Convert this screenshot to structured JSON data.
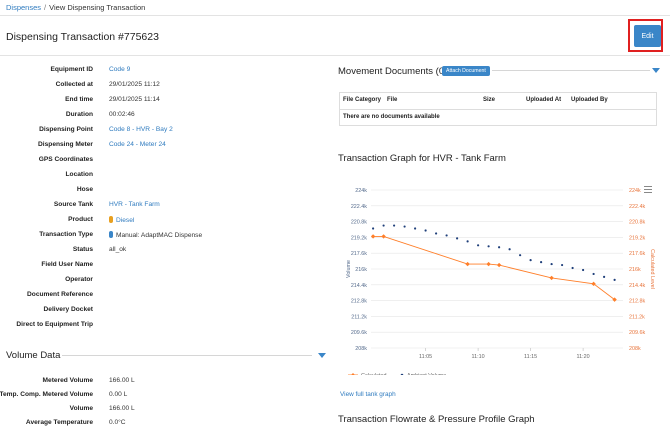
{
  "breadcrumb": {
    "parent": "Dispenses",
    "separator": "/",
    "current": "View Dispensing Transaction"
  },
  "page": {
    "title": "Dispensing Transaction #775623",
    "edit_label": "Edit"
  },
  "details": [
    {
      "label": "Equipment ID",
      "value": "Code 9",
      "link": true
    },
    {
      "label": "Collected at",
      "value": "29/01/2025 11:12",
      "link": false
    },
    {
      "label": "End time",
      "value": "29/01/2025 11:14",
      "link": false
    },
    {
      "label": "Duration",
      "value": "00:02:46",
      "link": false
    },
    {
      "label": "Dispensing Point",
      "value": "Code 8 - HVR - Bay 2",
      "link": true
    },
    {
      "label": "Dispensing Meter",
      "value": "Code 24 - Meter 24",
      "link": true
    },
    {
      "label": "GPS Coordinates",
      "value": "",
      "link": false
    },
    {
      "label": "Location",
      "value": "",
      "link": false
    },
    {
      "label": "Hose",
      "value": "",
      "link": false
    },
    {
      "label": "Source Tank",
      "value": "HVR - Tank Farm",
      "link": true
    },
    {
      "label": "Product",
      "value": "Diesel",
      "link": true,
      "dot": "#e8a020"
    },
    {
      "label": "Transaction Type",
      "value": "Manual: AdaptMAC Dispense",
      "link": false,
      "dot": "#3a86c8"
    },
    {
      "label": "Status",
      "value": "all_ok",
      "link": false
    },
    {
      "label": "Field User Name",
      "value": "",
      "link": false
    },
    {
      "label": "Operator",
      "value": "",
      "link": false
    },
    {
      "label": "Document Reference",
      "value": "",
      "link": false
    },
    {
      "label": "Delivery Docket",
      "value": "",
      "link": false
    },
    {
      "label": "Direct to Equipment Trip",
      "value": "",
      "link": false
    }
  ],
  "volume_section": {
    "title": "Volume Data",
    "rows": [
      {
        "label": "Metered Volume",
        "value": "166.00 L"
      },
      {
        "label": "Temp. Comp. Metered Volume",
        "value": "0.00 L"
      },
      {
        "label": "Volume",
        "value": "166.00 L"
      },
      {
        "label": "Average Temperature",
        "value": "0.0°C"
      }
    ]
  },
  "movement_documents": {
    "title": "Movement Documents (0)",
    "attach_label": "Attach Document",
    "columns": [
      "File Category",
      "File",
      "Size",
      "Uploaded At",
      "Uploaded By"
    ],
    "empty_text": "There are no documents available"
  },
  "transaction_graph": {
    "title": "Transaction Graph for HVR - Tank Farm",
    "view_full_link": "View full tank graph",
    "next_section_title": "Transaction Flowrate & Pressure Profile Graph",
    "colors": {
      "calculated": "#ff7f2a",
      "ambient": "#1f3f7a",
      "left_axis": "#556b8c",
      "right_axis": "#e8743b"
    }
  },
  "chart_data": {
    "type": "line",
    "ylabel_left": "Volume",
    "ylabel_right": "Calculated Level",
    "y_ticks_left": [
      "224k",
      "222.4k",
      "220.8k",
      "219.2k",
      "217.6k",
      "216k",
      "214.4k",
      "212.8k",
      "211.2k",
      "209.6k",
      "208k"
    ],
    "y_ticks_right": [
      "224k",
      "222.4k",
      "220.8k",
      "219.2k",
      "217.6k",
      "216k",
      "214.4k",
      "212.8k",
      "211.2k",
      "209.6k",
      "208k"
    ],
    "x_ticks": [
      "11:05",
      "11:10",
      "11:15",
      "11:20"
    ],
    "ylim": [
      208000,
      224000
    ],
    "xlim_minutes": [
      11.0,
      11.4
    ],
    "series": [
      {
        "name": "Calculated",
        "marker": "diamond",
        "x": [
          "11:00",
          "11:01",
          "11:09",
          "11:11",
          "11:12",
          "11:17",
          "11:21",
          "11:23"
        ],
        "y": [
          219300,
          219300,
          216500,
          216500,
          216400,
          215100,
          214500,
          212900
        ]
      },
      {
        "name": "Ambient Volume",
        "marker": "dot",
        "x": [
          "11:00",
          "11:01",
          "11:02",
          "11:03",
          "11:04",
          "11:05",
          "11:06",
          "11:07",
          "11:08",
          "11:09",
          "11:10",
          "11:11",
          "11:12",
          "11:13",
          "11:14",
          "11:15",
          "11:16",
          "11:17",
          "11:18",
          "11:19",
          "11:20",
          "11:21",
          "11:22",
          "11:23"
        ],
        "y": [
          220100,
          220400,
          220400,
          220300,
          220100,
          219900,
          219600,
          219400,
          219100,
          218800,
          218400,
          218300,
          218200,
          218000,
          217400,
          216900,
          216700,
          216500,
          216400,
          216100,
          215900,
          215500,
          215200,
          214900
        ]
      }
    ]
  }
}
